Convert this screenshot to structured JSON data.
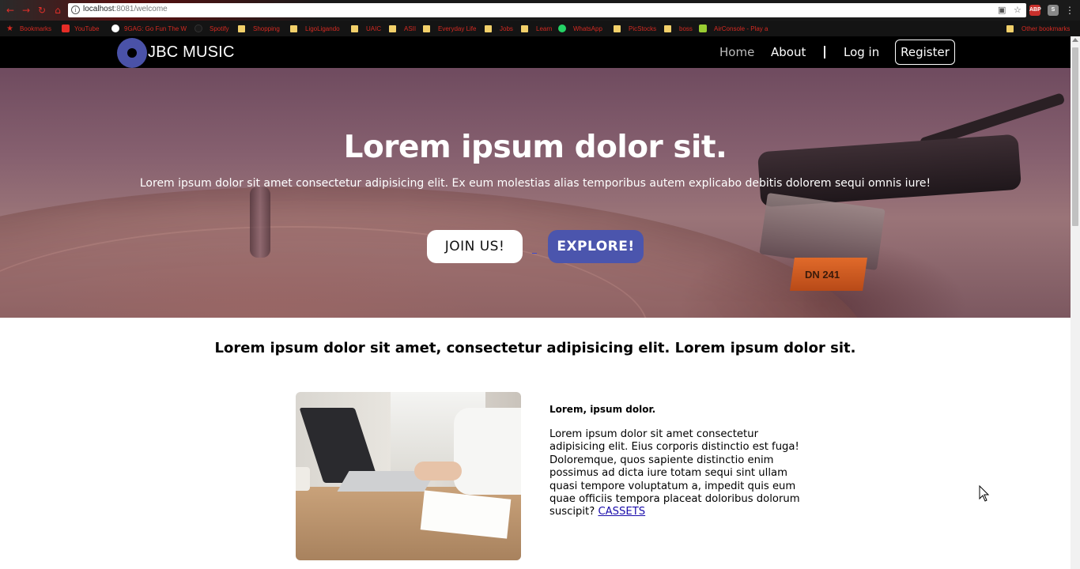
{
  "browser": {
    "url_host": "localhost",
    "url_rest": ":8081/welcome",
    "bookmarks": [
      {
        "label": "Bookmarks",
        "icon": "star-icon"
      },
      {
        "label": "YouTube",
        "icon": "youtube-icon"
      },
      {
        "label": "9GAG: Go Fun The W",
        "icon": "9gag-icon"
      },
      {
        "label": "Spotify",
        "icon": "spotify-icon"
      },
      {
        "label": "Shopping",
        "icon": "folder-icon"
      },
      {
        "label": "LigoLigando",
        "icon": "folder-icon"
      },
      {
        "label": "UAIC",
        "icon": "folder-icon"
      },
      {
        "label": "ASII",
        "icon": "folder-icon"
      },
      {
        "label": "Everyday Life",
        "icon": "folder-icon"
      },
      {
        "label": "Jobs",
        "icon": "folder-icon"
      },
      {
        "label": "Learn",
        "icon": "folder-icon"
      },
      {
        "label": "WhatsApp",
        "icon": "whatsapp-icon"
      },
      {
        "label": "PicStocks",
        "icon": "folder-icon"
      },
      {
        "label": "boss",
        "icon": "folder-icon"
      },
      {
        "label": "AirConsole - Play a",
        "icon": "airconsole-icon"
      },
      {
        "label": "Other bookmarks",
        "icon": "folder-icon"
      }
    ],
    "extensions": [
      "ABP",
      "S"
    ]
  },
  "site": {
    "brand": "JBC MUSIC",
    "nav": {
      "home": "Home",
      "about": "About",
      "separator": "|",
      "login": "Log in",
      "register": "Register"
    },
    "hero": {
      "title": "Lorem ipsum dolor sit.",
      "subtitle": "Lorem ipsum dolor sit amet consectetur adipisicing elit. Ex eum molestias alias temporibus autem explicabo debitis dolorem sequi omnis iure!",
      "join_label": "JOIN US!",
      "explore_label": "EXPLORE!",
      "turntable_label": "DN 241"
    },
    "lead": "Lorem ipsum dolor sit amet, consectetur adipisicing elit. Lorem ipsum dolor sit.",
    "card": {
      "title": "Lorem, ipsum dolor.",
      "text": "Lorem ipsum dolor sit amet consectetur adipisicing elit. Eius corporis distinctio est fuga! Doloremque, quos sapiente distinctio enim possimus ad dicta iure totam sequi sint ullam quasi tempore voluptatum a, impedit quis eum quae officiis tempora placeat doloribus dolorum suscipit?",
      "link": "CASSETS"
    }
  },
  "colors": {
    "accent": "#4b55ad",
    "nav_bg": "#000000",
    "link": "#1a0dab"
  }
}
